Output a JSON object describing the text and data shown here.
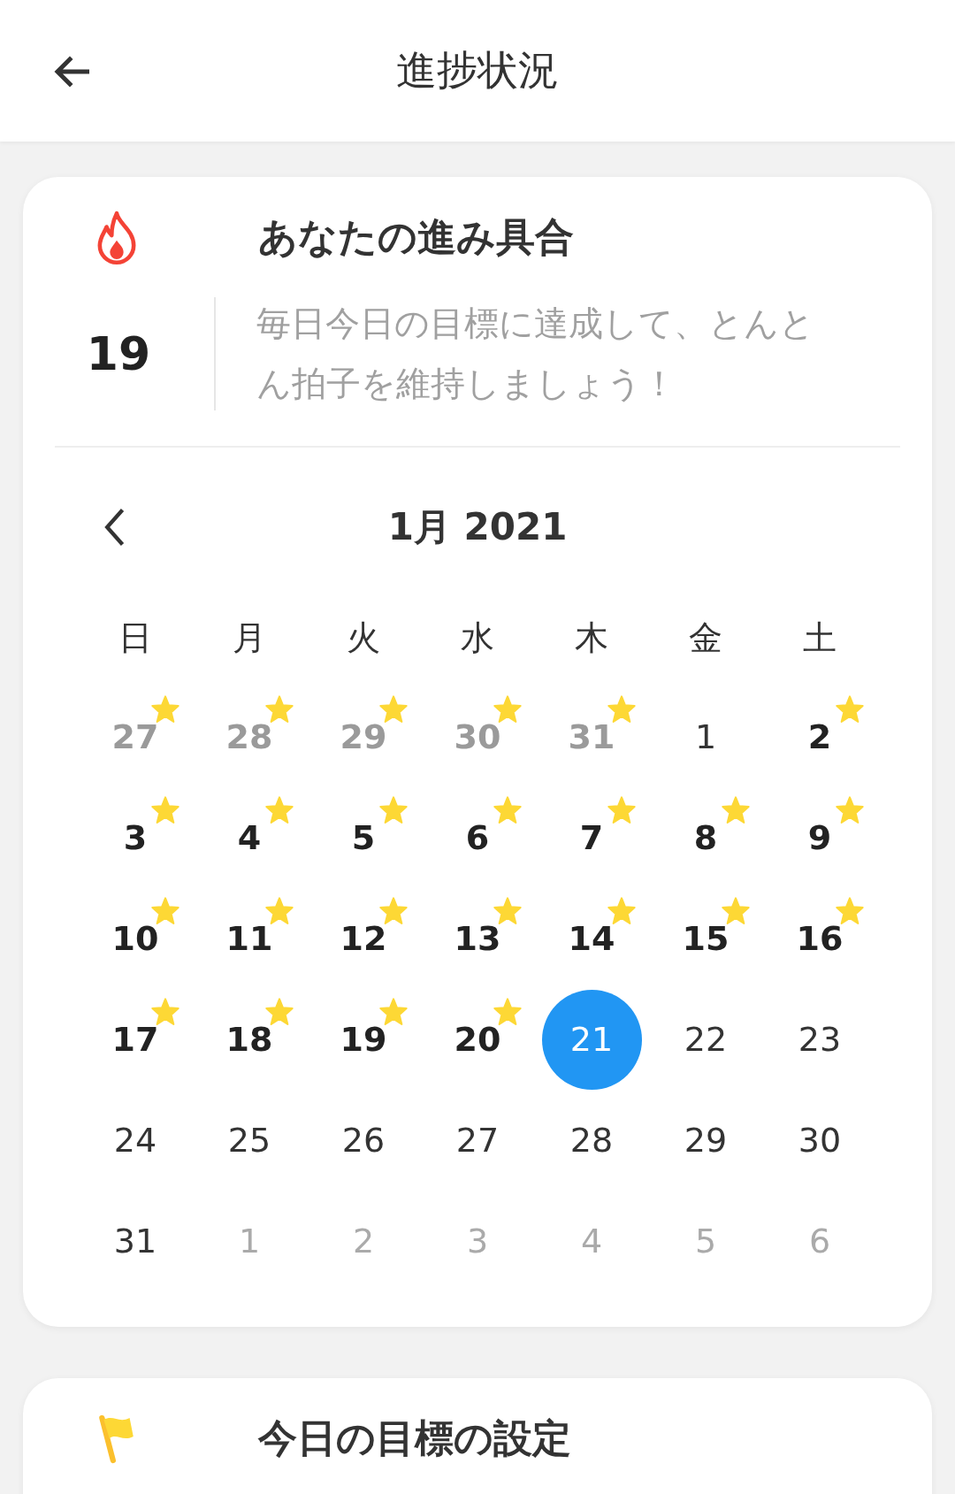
{
  "header": {
    "title": "進捗状況"
  },
  "progress_card": {
    "title": "あなたの進み具合",
    "streak": "19",
    "message": "毎日今日の目標に達成して、とんとん拍子を維持しましょう！",
    "calendar": {
      "month_title": "1月 2021",
      "weekdays": [
        "日",
        "月",
        "火",
        "水",
        "木",
        "金",
        "土"
      ],
      "weeks": [
        [
          {
            "label": "27",
            "in_month": false,
            "done": true,
            "selected": false
          },
          {
            "label": "28",
            "in_month": false,
            "done": true,
            "selected": false
          },
          {
            "label": "29",
            "in_month": false,
            "done": true,
            "selected": false
          },
          {
            "label": "30",
            "in_month": false,
            "done": true,
            "selected": false
          },
          {
            "label": "31",
            "in_month": false,
            "done": true,
            "selected": false
          },
          {
            "label": "1",
            "in_month": true,
            "done": false,
            "selected": false
          },
          {
            "label": "2",
            "in_month": true,
            "done": true,
            "selected": false
          }
        ],
        [
          {
            "label": "3",
            "in_month": true,
            "done": true,
            "selected": false
          },
          {
            "label": "4",
            "in_month": true,
            "done": true,
            "selected": false
          },
          {
            "label": "5",
            "in_month": true,
            "done": true,
            "selected": false
          },
          {
            "label": "6",
            "in_month": true,
            "done": true,
            "selected": false
          },
          {
            "label": "7",
            "in_month": true,
            "done": true,
            "selected": false
          },
          {
            "label": "8",
            "in_month": true,
            "done": true,
            "selected": false
          },
          {
            "label": "9",
            "in_month": true,
            "done": true,
            "selected": false
          }
        ],
        [
          {
            "label": "10",
            "in_month": true,
            "done": true,
            "selected": false
          },
          {
            "label": "11",
            "in_month": true,
            "done": true,
            "selected": false
          },
          {
            "label": "12",
            "in_month": true,
            "done": true,
            "selected": false
          },
          {
            "label": "13",
            "in_month": true,
            "done": true,
            "selected": false
          },
          {
            "label": "14",
            "in_month": true,
            "done": true,
            "selected": false
          },
          {
            "label": "15",
            "in_month": true,
            "done": true,
            "selected": false
          },
          {
            "label": "16",
            "in_month": true,
            "done": true,
            "selected": false
          }
        ],
        [
          {
            "label": "17",
            "in_month": true,
            "done": true,
            "selected": false
          },
          {
            "label": "18",
            "in_month": true,
            "done": true,
            "selected": false
          },
          {
            "label": "19",
            "in_month": true,
            "done": true,
            "selected": false
          },
          {
            "label": "20",
            "in_month": true,
            "done": true,
            "selected": false
          },
          {
            "label": "21",
            "in_month": true,
            "done": false,
            "selected": true
          },
          {
            "label": "22",
            "in_month": true,
            "done": false,
            "selected": false
          },
          {
            "label": "23",
            "in_month": true,
            "done": false,
            "selected": false
          }
        ],
        [
          {
            "label": "24",
            "in_month": true,
            "done": false,
            "selected": false
          },
          {
            "label": "25",
            "in_month": true,
            "done": false,
            "selected": false
          },
          {
            "label": "26",
            "in_month": true,
            "done": false,
            "selected": false
          },
          {
            "label": "27",
            "in_month": true,
            "done": false,
            "selected": false
          },
          {
            "label": "28",
            "in_month": true,
            "done": false,
            "selected": false
          },
          {
            "label": "29",
            "in_month": true,
            "done": false,
            "selected": false
          },
          {
            "label": "30",
            "in_month": true,
            "done": false,
            "selected": false
          }
        ],
        [
          {
            "label": "31",
            "in_month": true,
            "done": false,
            "selected": false
          },
          {
            "label": "1",
            "in_month": false,
            "done": false,
            "selected": false
          },
          {
            "label": "2",
            "in_month": false,
            "done": false,
            "selected": false
          },
          {
            "label": "3",
            "in_month": false,
            "done": false,
            "selected": false
          },
          {
            "label": "4",
            "in_month": false,
            "done": false,
            "selected": false
          },
          {
            "label": "5",
            "in_month": false,
            "done": false,
            "selected": false
          },
          {
            "label": "6",
            "in_month": false,
            "done": false,
            "selected": false
          }
        ]
      ]
    }
  },
  "goal_card": {
    "title": "今日の目標の設定"
  }
}
